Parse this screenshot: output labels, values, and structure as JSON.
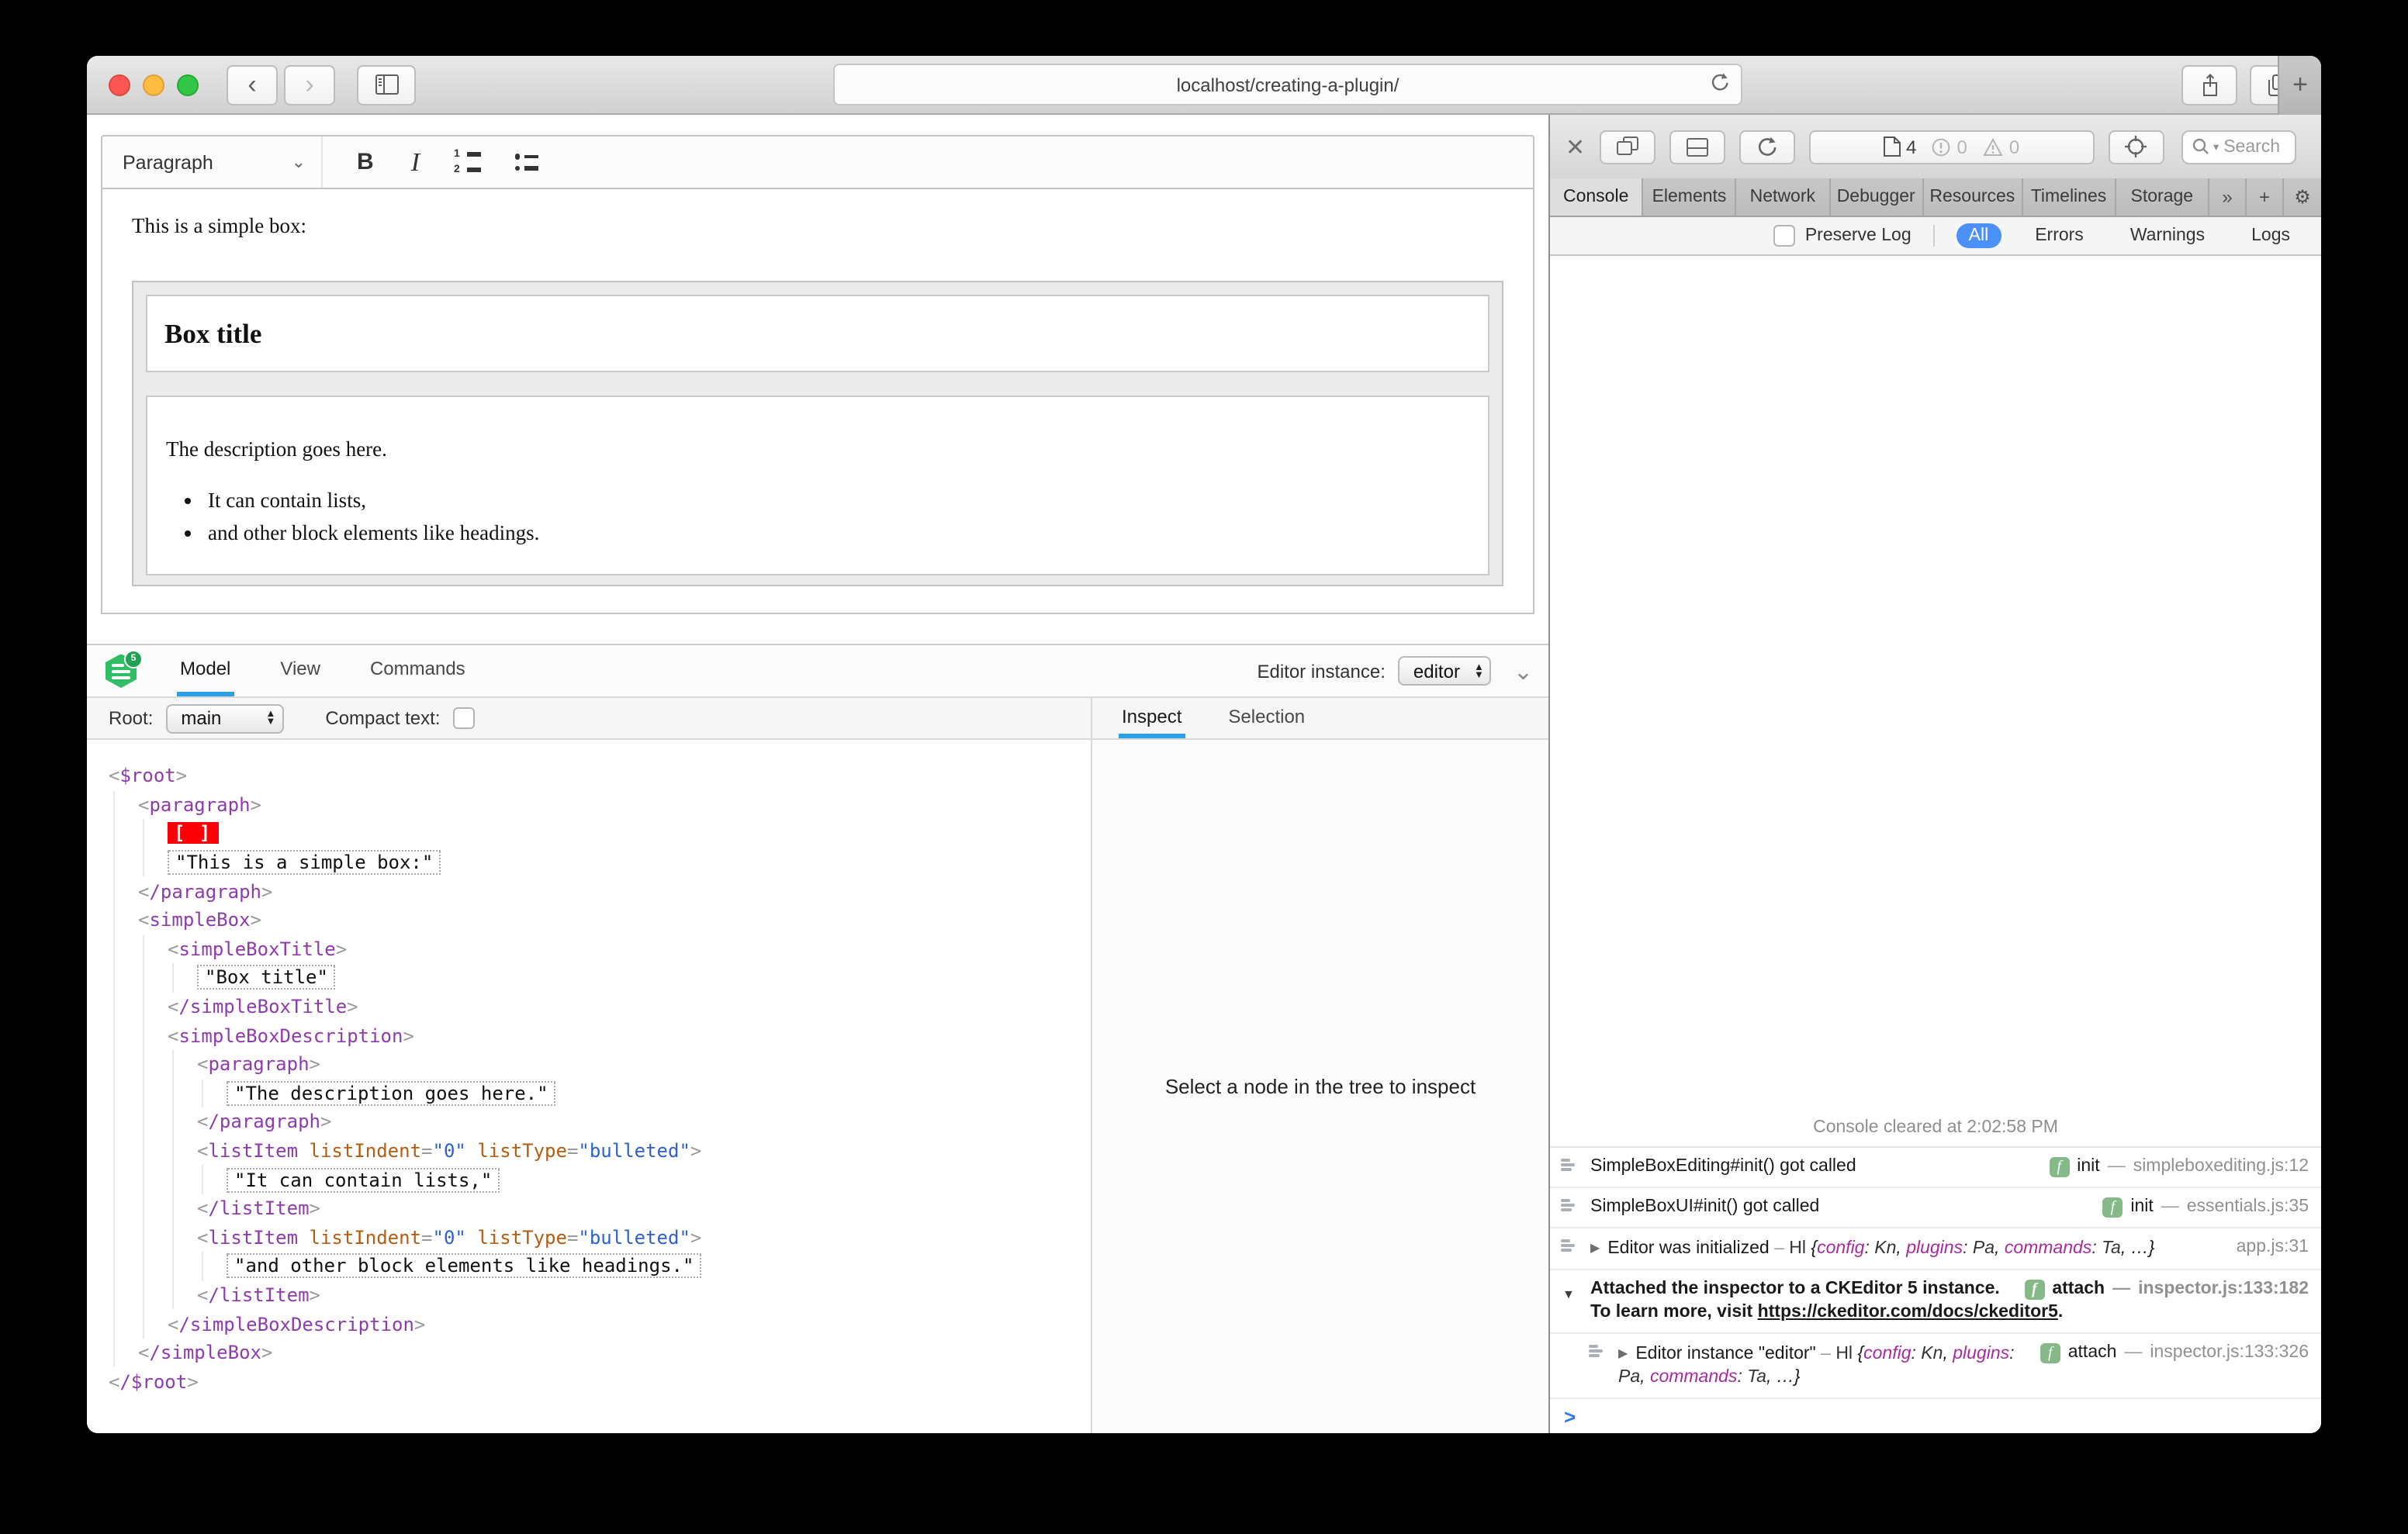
{
  "browser": {
    "url": "localhost/creating-a-plugin/"
  },
  "icons": {
    "back": "‹",
    "forward": "›",
    "new_tab_plus": "+",
    "overflow": "»",
    "gear": "⚙",
    "chevron_down": "⌄",
    "stepper_up": "▲",
    "stepper_down": "▼",
    "disclosure_closed": "▶",
    "disclosure_open": "▼",
    "close_x": "✕"
  },
  "editor": {
    "style_dropdown": "Paragraph",
    "intro": "This is a simple box:",
    "box_title": "Box title",
    "description": "The description goes here.",
    "bullets": [
      "It can contain lists,",
      "and other block elements like headings."
    ]
  },
  "inspector": {
    "tabs": [
      {
        "label": "Model",
        "active": true
      },
      {
        "label": "View",
        "active": false
      },
      {
        "label": "Commands",
        "active": false
      }
    ],
    "root_label": "Root:",
    "root_value": "main",
    "compact_label": "Compact text:",
    "instance_label": "Editor instance:",
    "instance_value": "editor",
    "pane_tabs": [
      {
        "label": "Inspect",
        "active": true
      },
      {
        "label": "Selection",
        "active": false
      }
    ],
    "empty_message": "Select a node in the tree to inspect",
    "colors": {
      "tag": "#8e3bad",
      "attr_name": "#b35c12",
      "attr_value": "#2e62c9",
      "marker_bg": "#fb0007",
      "active_tab_underline": "#2b9fe8",
      "logo_green": "#2fbe63"
    },
    "model_tree": [
      {
        "i": 0,
        "t": "open",
        "name": "$root"
      },
      {
        "i": 1,
        "t": "open",
        "name": "paragraph"
      },
      {
        "i": 2,
        "t": "marker",
        "label": "[ ]"
      },
      {
        "i": 2,
        "t": "text",
        "value": "\"This is a simple box:\""
      },
      {
        "i": 1,
        "t": "close",
        "name": "paragraph"
      },
      {
        "i": 1,
        "t": "open",
        "name": "simpleBox"
      },
      {
        "i": 2,
        "t": "open",
        "name": "simpleBoxTitle"
      },
      {
        "i": 3,
        "t": "text",
        "value": "\"Box title\""
      },
      {
        "i": 2,
        "t": "close",
        "name": "simpleBoxTitle"
      },
      {
        "i": 2,
        "t": "open",
        "name": "simpleBoxDescription"
      },
      {
        "i": 3,
        "t": "open",
        "name": "paragraph"
      },
      {
        "i": 4,
        "t": "text",
        "value": "\"The description goes here.\""
      },
      {
        "i": 3,
        "t": "close",
        "name": "paragraph"
      },
      {
        "i": 3,
        "t": "open",
        "name": "listItem",
        "attrs": [
          [
            "listIndent",
            "0"
          ],
          [
            "listType",
            "bulleted"
          ]
        ]
      },
      {
        "i": 4,
        "t": "text",
        "value": "\"It can contain lists,\""
      },
      {
        "i": 3,
        "t": "close",
        "name": "listItem"
      },
      {
        "i": 3,
        "t": "open",
        "name": "listItem",
        "attrs": [
          [
            "listIndent",
            "0"
          ],
          [
            "listType",
            "bulleted"
          ]
        ]
      },
      {
        "i": 4,
        "t": "text",
        "value": "\"and other block elements like headings.\""
      },
      {
        "i": 3,
        "t": "close",
        "name": "listItem"
      },
      {
        "i": 2,
        "t": "close",
        "name": "simpleBoxDescription"
      },
      {
        "i": 1,
        "t": "close",
        "name": "simpleBox"
      },
      {
        "i": 0,
        "t": "close",
        "name": "$root"
      }
    ]
  },
  "devtools": {
    "toolbar": {
      "pages": "4",
      "errors": "0",
      "warnings": "0",
      "search_placeholder": "Search"
    },
    "tabs": [
      {
        "label": "Console",
        "active": true
      },
      {
        "label": "Elements",
        "active": false
      },
      {
        "label": "Network",
        "active": false
      },
      {
        "label": "Debugger",
        "active": false
      },
      {
        "label": "Resources",
        "active": false
      },
      {
        "label": "Timelines",
        "active": false
      },
      {
        "label": "Storage",
        "active": false
      }
    ],
    "preserve_log_label": "Preserve Log",
    "filters": [
      {
        "label": "All",
        "active": true
      },
      {
        "label": "Errors",
        "active": false
      },
      {
        "label": "Warnings",
        "active": false
      },
      {
        "label": "Logs",
        "active": false
      }
    ],
    "console": {
      "cleared": "Console cleared at 2:02:58 PM",
      "messages": [
        {
          "text": "SimpleBoxEditing#init() got called",
          "badge": "init",
          "location": "simpleboxediting.js:12"
        },
        {
          "text": "SimpleBoxUI#init() got called",
          "badge": "init",
          "location": "essentials.js:35"
        },
        {
          "disclosure": "closed",
          "text": "Editor was initialized",
          "preview": {
            "cls": "Hl",
            "pairs": [
              [
                "config",
                "Kn"
              ],
              [
                "plugins",
                "Pa"
              ],
              [
                "commands",
                "Ta"
              ]
            ],
            "more": "…"
          },
          "location": "app.js:31"
        },
        {
          "disclosure": "open",
          "bold": true,
          "text": "Attached the inspector to a CKEditor 5 instance. To learn more, visit ",
          "link": "https://ckeditor.com/docs/ckeditor5",
          "after_link": ".",
          "badge": "attach",
          "location": "inspector.js:133:182"
        },
        {
          "disclosure": "closed",
          "nested": true,
          "text": "Editor instance \"editor\"",
          "preview": {
            "cls": "Hl",
            "pairs": [
              [
                "config",
                "Kn"
              ],
              [
                "plugins",
                "Pa"
              ],
              [
                "commands",
                "Ta"
              ]
            ],
            "more": "…"
          },
          "badge": "attach",
          "location": "inspector.js:133:326"
        }
      ],
      "prompt": ">"
    }
  }
}
